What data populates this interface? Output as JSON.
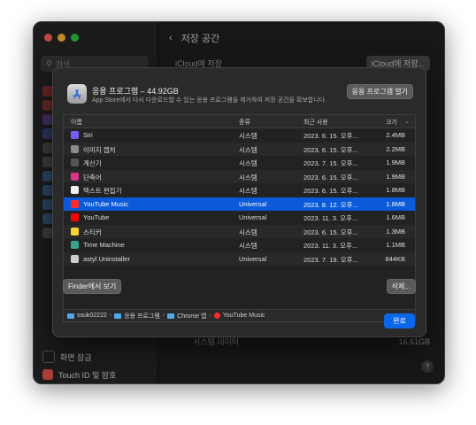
{
  "window": {
    "header_title": "저장 공간",
    "bg_row1_label": "iCloud에 저장",
    "bg_row1_button": "iCloud에 저장...",
    "bg_bottom_label": "시스템 데이터",
    "bg_bottom_value": "16.61GB",
    "help": "?"
  },
  "sidebar": {
    "search_placeholder": "검색",
    "bottom_items": [
      {
        "label": "화면 잠금"
      },
      {
        "label": "Touch ID 및 암호"
      }
    ]
  },
  "sheet": {
    "title": "응용 프로그램 – 44.92GB",
    "subtitle": "App Store에서 다시 다운로드할 수 있는 응용 프로그램을 제거하여 저장 공간을 확보합니다.",
    "open_button": "응용 프로그램 열기",
    "columns": {
      "name": "이름",
      "kind": "종류",
      "date": "최근 사용",
      "size": "크기"
    },
    "rows": [
      {
        "name": "Siri",
        "kind": "시스템",
        "date": "2023. 6. 15. 오후...",
        "size": "2.4MB",
        "icon": "siri-icon",
        "color": "#7a5af5"
      },
      {
        "name": "이미지 캡처",
        "kind": "시스템",
        "date": "2023. 6. 15. 오후...",
        "size": "2.2MB",
        "icon": "image-capture-icon",
        "color": "#8a8a8a"
      },
      {
        "name": "계산기",
        "kind": "시스템",
        "date": "2023. 7. 15. 오후...",
        "size": "1.9MB",
        "icon": "calculator-icon",
        "color": "#555555"
      },
      {
        "name": "단축어",
        "kind": "시스템",
        "date": "2023. 6. 15. 오후...",
        "size": "1.9MB",
        "icon": "shortcuts-icon",
        "color": "#d9338b"
      },
      {
        "name": "텍스트 편집기",
        "kind": "시스템",
        "date": "2023. 6. 15. 오후...",
        "size": "1.8MB",
        "icon": "textedit-icon",
        "color": "#f1f1f1"
      },
      {
        "name": "YouTube Music",
        "kind": "Universal",
        "date": "2023. 8. 12. 오후...",
        "size": "1.6MB",
        "icon": "youtube-music-icon",
        "color": "#ff2a2a"
      },
      {
        "name": "YouTube",
        "kind": "Universal",
        "date": "2023. 11. 3. 오후...",
        "size": "1.6MB",
        "icon": "youtube-icon",
        "color": "#ff0000"
      },
      {
        "name": "스티커",
        "kind": "시스템",
        "date": "2023. 6. 15. 오후...",
        "size": "1.3MB",
        "icon": "stickies-icon",
        "color": "#f5d133"
      },
      {
        "name": "Time Machine",
        "kind": "시스템",
        "date": "2023. 11. 3. 오후...",
        "size": "1.1MB",
        "icon": "time-machine-icon",
        "color": "#3aa38d"
      },
      {
        "name": "astyl Uninstaller",
        "kind": "Universal",
        "date": "2023. 7. 19. 오후...",
        "size": "844KB",
        "icon": "uninstaller-icon",
        "color": "#cccccc"
      }
    ],
    "selected_index": 5,
    "path": [
      "ssuk02222",
      "응용 프로그램",
      "Chrome 앱",
      "YouTube Music"
    ],
    "finder_button": "Finder에서 보기",
    "delete_button": "삭제...",
    "done_button": "완료"
  }
}
